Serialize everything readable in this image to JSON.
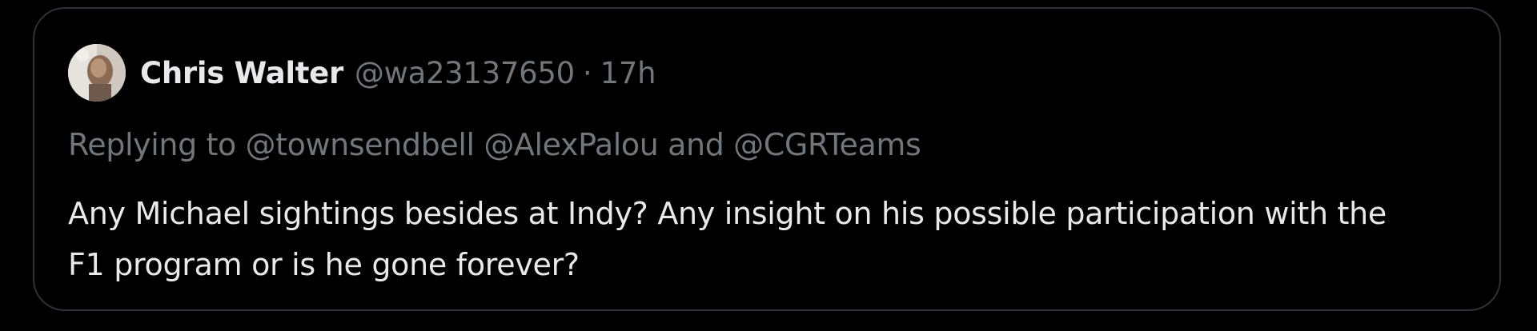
{
  "tweet": {
    "author": {
      "display_name": "Chris Walter",
      "handle": "@wa23137650",
      "avatar": "avatar-photo"
    },
    "separator": "·",
    "time": "17h",
    "replying": {
      "prefix": "Replying to",
      "mention_1": "@townsendbell",
      "mention_2": "@AlexPalou",
      "conjunction": "and",
      "mention_3": "@CGRTeams"
    },
    "text": "Any Michael sightings besides at Indy? Any insight on his possible participation with the F1 program or is he gone forever?"
  },
  "colors": {
    "background": "#000000",
    "border": "#2f3336",
    "primary_text": "#e7e9ea",
    "secondary_text": "#71767b"
  }
}
